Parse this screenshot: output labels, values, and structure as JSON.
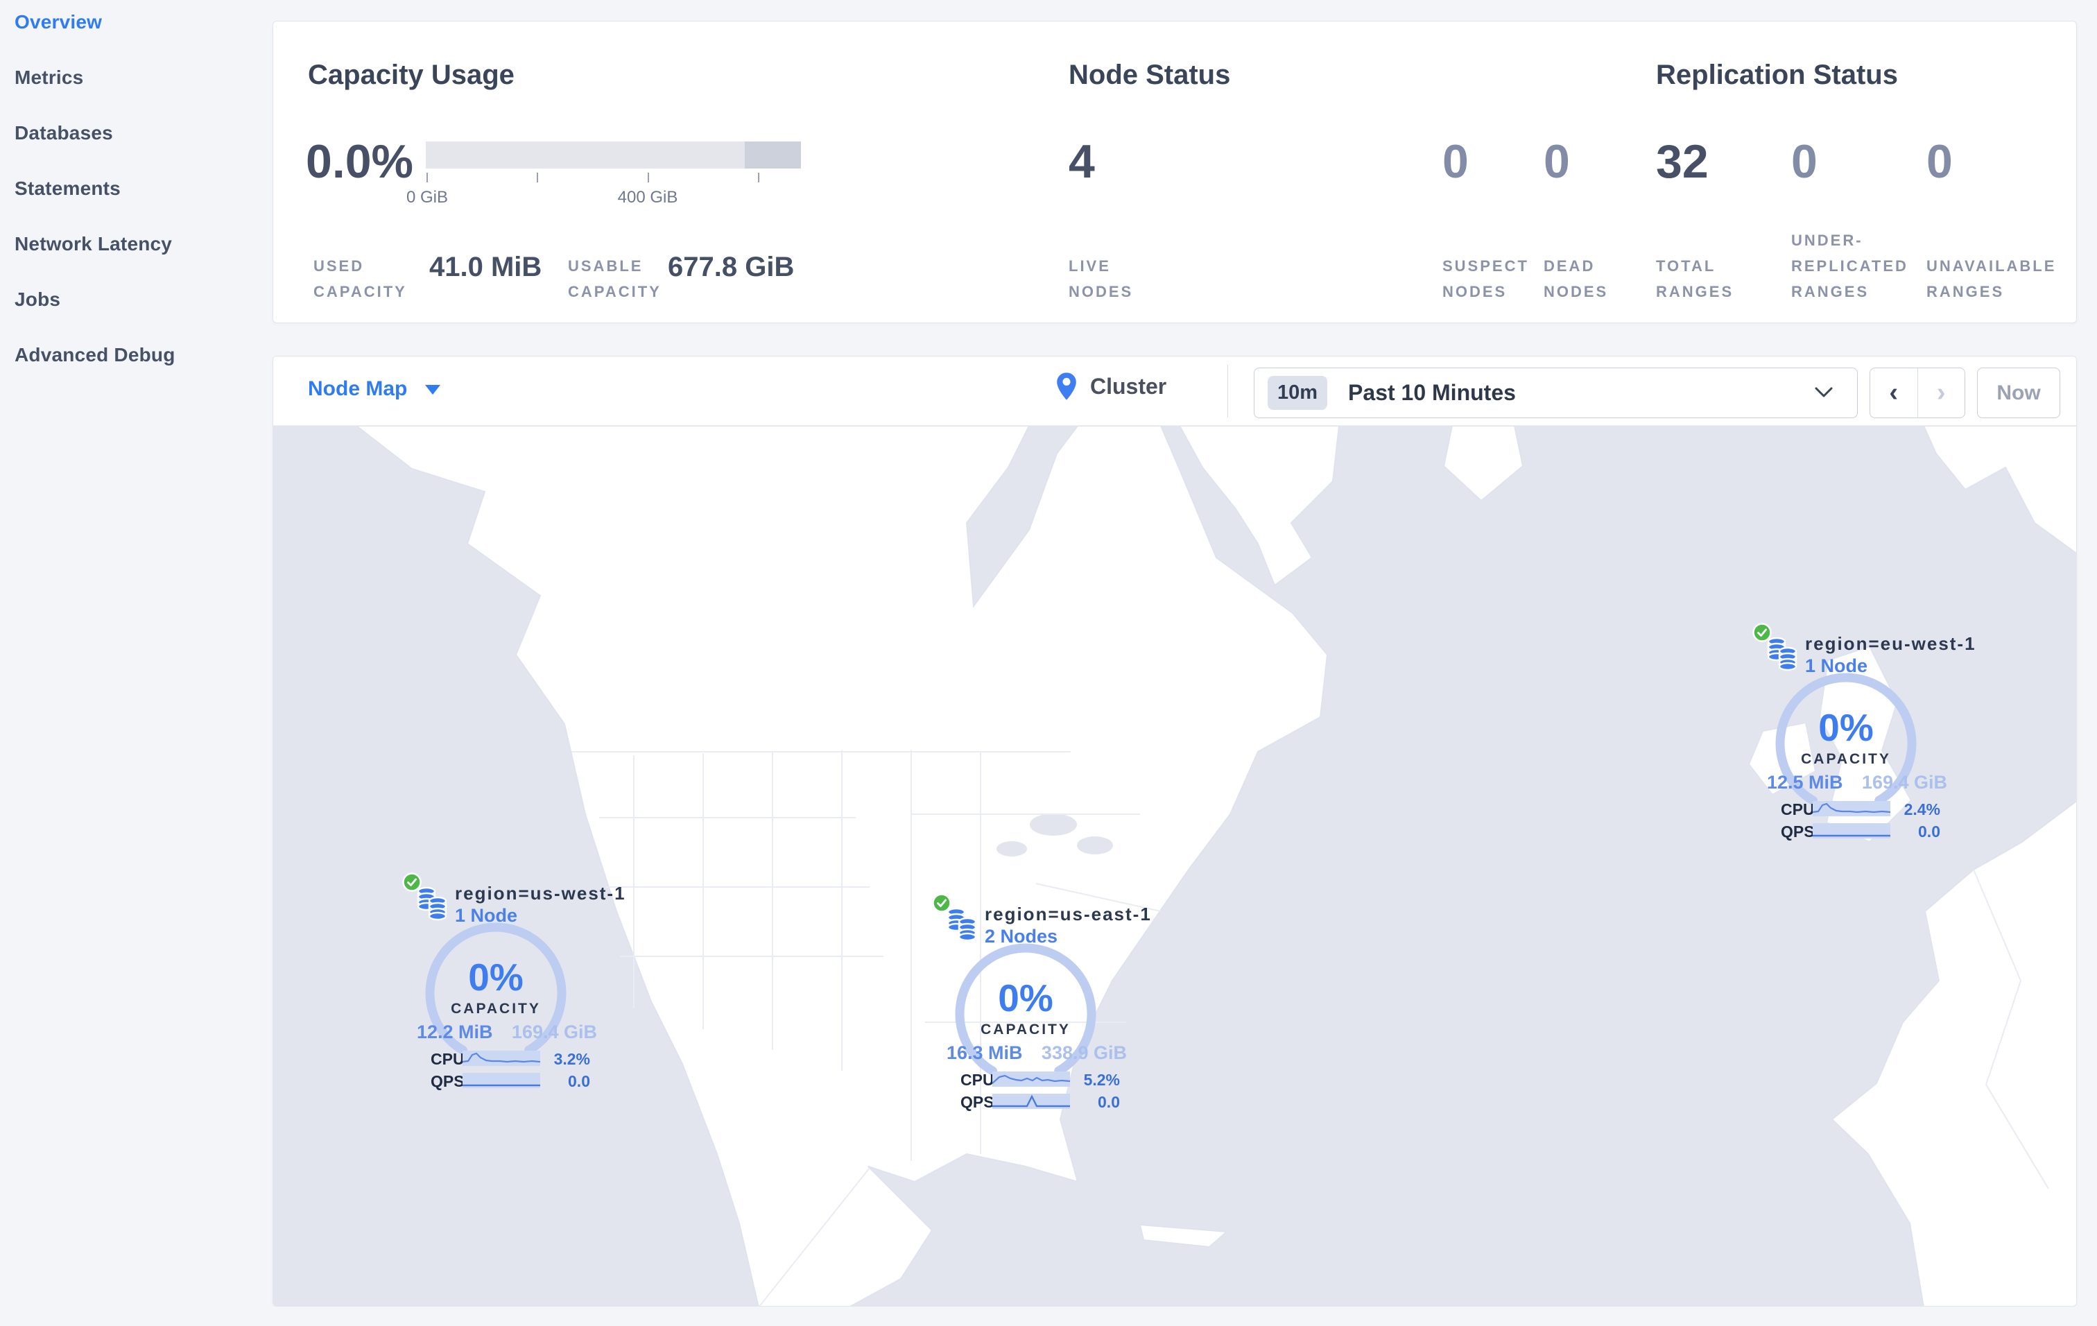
{
  "sidebar": {
    "items": [
      {
        "label": "Overview",
        "active": true
      },
      {
        "label": "Metrics",
        "active": false
      },
      {
        "label": "Databases",
        "active": false
      },
      {
        "label": "Statements",
        "active": false
      },
      {
        "label": "Network Latency",
        "active": false
      },
      {
        "label": "Jobs",
        "active": false
      },
      {
        "label": "Advanced Debug",
        "active": false
      }
    ]
  },
  "capacity": {
    "title": "Capacity Usage",
    "percent": "0.0%",
    "tick_labels": [
      "0 GiB",
      "400 GiB"
    ],
    "used_label": "USED CAPACITY",
    "used_value": "41.0 MiB",
    "usable_label": "USABLE CAPACITY",
    "usable_value": "677.8 GiB"
  },
  "node_status": {
    "title": "Node Status",
    "stats": [
      {
        "value": "4",
        "label": "LIVE NODES"
      },
      {
        "value": "0",
        "label": "SUSPECT NODES"
      },
      {
        "value": "0",
        "label": "DEAD NODES"
      }
    ]
  },
  "replication": {
    "title": "Replication Status",
    "stats": [
      {
        "value": "32",
        "label": "TOTAL RANGES"
      },
      {
        "value": "0",
        "label": "UNDER-REPLICATED RANGES"
      },
      {
        "value": "0",
        "label": "UNAVAILABLE RANGES"
      }
    ]
  },
  "toolbar": {
    "view_selector": "Node Map",
    "breadcrumb": "Cluster",
    "time_badge": "10m",
    "time_range": "Past 10 Minutes",
    "prev_label": "‹",
    "next_label": "›",
    "now_label": "Now"
  },
  "markers": [
    {
      "region": "region=us-west-1",
      "nodes": "1 Node",
      "capacity_percent": "0%",
      "capacity_label": "CAPACITY",
      "used": "12.2 MiB",
      "total": "169.4 GiB",
      "cpu_label": "CPU",
      "cpu_value": "3.2%",
      "qps_label": "QPS",
      "qps_value": "0.0"
    },
    {
      "region": "region=us-east-1",
      "nodes": "2 Nodes",
      "capacity_percent": "0%",
      "capacity_label": "CAPACITY",
      "used": "16.3 MiB",
      "total": "338.9 GiB",
      "cpu_label": "CPU",
      "cpu_value": "5.2%",
      "qps_label": "QPS",
      "qps_value": "0.0"
    },
    {
      "region": "region=eu-west-1",
      "nodes": "1 Node",
      "capacity_percent": "0%",
      "capacity_label": "CAPACITY",
      "used": "12.5 MiB",
      "total": "169.4 GiB",
      "cpu_label": "CPU",
      "cpu_value": "2.4%",
      "qps_label": "QPS",
      "qps_value": "0.0"
    }
  ],
  "colors": {
    "accent_blue": "#2f7cf2",
    "marker_blue": "#3d7df0",
    "healthy_green": "#4db848",
    "ocean": "#e2e5ed",
    "land": "#ffffff",
    "text_dark": "#3b4559",
    "text_dim": "#8c93a8"
  }
}
